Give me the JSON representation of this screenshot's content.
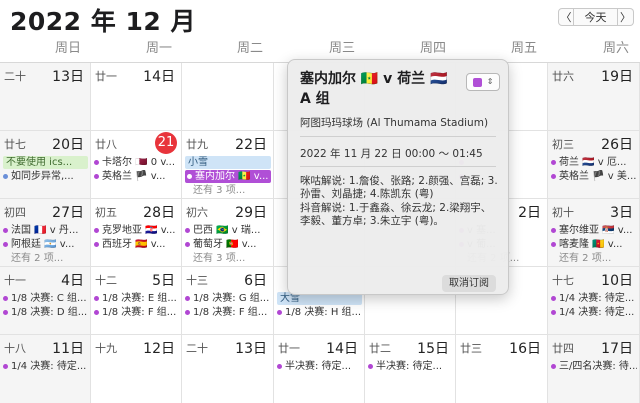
{
  "header": {
    "title": "2022 年 12 月",
    "prev_label": "〈",
    "today_label": "今天",
    "next_label": "〉"
  },
  "weekdays": [
    "周日",
    "周一",
    "周二",
    "周三",
    "周四",
    "周五",
    "周六"
  ],
  "weeks": [
    [
      {
        "lunar": "二十",
        "day": "13日",
        "events": []
      },
      {
        "lunar": "廿一",
        "day": "14日",
        "events": []
      },
      {
        "lunar": "",
        "day": "",
        "events": []
      },
      {
        "lunar": "",
        "day": "",
        "events": []
      },
      {
        "lunar": "",
        "day": "",
        "events": []
      },
      {
        "lunar": "",
        "day": "",
        "events": []
      },
      {
        "lunar": "廿六",
        "day": "19日",
        "events": []
      }
    ],
    [
      {
        "lunar": "廿七",
        "day": "20日",
        "events": [
          {
            "text": "不要使用 ics...",
            "style": "pill-green"
          },
          {
            "text": "如同步异常,...",
            "style": "dot-blue"
          }
        ]
      },
      {
        "lunar": "廿八",
        "day": "21",
        "events": [
          {
            "text": "卡塔尔 🇶🇦 0 v...",
            "style": "dot"
          },
          {
            "text": "英格兰 🏴 v...",
            "style": "dot"
          }
        ]
      },
      {
        "lunar": "廿九",
        "day": "22日",
        "events": [
          {
            "text": "小雪",
            "style": "pill-blue"
          },
          {
            "text": "塞内加尔 🇸🇳 v...",
            "style": "pill-sel"
          },
          {
            "text": "还有 3 项...",
            "style": "more"
          }
        ]
      },
      {
        "lunar": "",
        "day": "",
        "events": []
      },
      {
        "lunar": "",
        "day": "",
        "events": []
      },
      {
        "lunar": "",
        "day": "",
        "events": [
          {
            "text": "",
            "style": "dot"
          },
          {
            "text": "",
            "style": "dot"
          }
        ]
      },
      {
        "lunar": "初三",
        "day": "26日",
        "events": [
          {
            "text": "荷兰 🇳🇱 v 厄...",
            "style": "dot"
          },
          {
            "text": "英格兰 🏴 v 美...",
            "style": "dot"
          }
        ]
      }
    ],
    [
      {
        "lunar": "初四",
        "day": "27日",
        "events": [
          {
            "text": "法国 🇫🇷 v 丹...",
            "style": "dot"
          },
          {
            "text": "阿根廷 🇦🇷 v...",
            "style": "dot"
          },
          {
            "text": "还有 2 项...",
            "style": "more"
          }
        ]
      },
      {
        "lunar": "初五",
        "day": "28日",
        "events": [
          {
            "text": "克罗地亚 🇭🇷 v...",
            "style": "dot"
          },
          {
            "text": "西班牙 🇪🇸 v...",
            "style": "dot"
          }
        ]
      },
      {
        "lunar": "初六",
        "day": "29日",
        "events": [
          {
            "text": "巴西 🇧🇷 v 瑞...",
            "style": "dot"
          },
          {
            "text": "葡萄牙 🇵🇹 v...",
            "style": "dot"
          },
          {
            "text": "还有 3 项...",
            "style": "more"
          }
        ]
      },
      {
        "lunar": "",
        "day": "",
        "events": []
      },
      {
        "lunar": "",
        "day": "",
        "events": []
      },
      {
        "lunar": "",
        "day": "2日",
        "events": [
          {
            "text": "v 塞...",
            "style": "dot"
          },
          {
            "text": "v 葡...",
            "style": "dot"
          },
          {
            "text": "还有 2 项...",
            "style": "more"
          }
        ]
      },
      {
        "lunar": "初十",
        "day": "3日",
        "events": [
          {
            "text": "塞尔维亚 🇷🇸 v...",
            "style": "dot"
          },
          {
            "text": "喀麦隆 🇨🇲 v...",
            "style": "dot"
          },
          {
            "text": "还有 2 项...",
            "style": "more"
          }
        ]
      }
    ],
    [
      {
        "lunar": "十一",
        "day": "4日",
        "events": [
          {
            "text": "1/8 决赛: C 组...",
            "style": "dot"
          },
          {
            "text": "1/8 决赛: D 组...",
            "style": "dot"
          }
        ]
      },
      {
        "lunar": "十二",
        "day": "5日",
        "events": [
          {
            "text": "1/8 决赛: E 组...",
            "style": "dot"
          },
          {
            "text": "1/8 决赛: F 组...",
            "style": "dot"
          }
        ]
      },
      {
        "lunar": "十三",
        "day": "6日",
        "events": [
          {
            "text": "1/8 决赛: G 组...",
            "style": "dot"
          },
          {
            "text": "1/8 决赛: F 组...",
            "style": "dot"
          }
        ]
      },
      {
        "lunar": "",
        "day": "",
        "events": [
          {
            "text": "大雪",
            "style": "pill-blue"
          },
          {
            "text": "1/8 决赛: H 组...",
            "style": "dot"
          }
        ]
      },
      {
        "lunar": "",
        "day": "",
        "events": []
      },
      {
        "lunar": "",
        "day": "",
        "events": []
      },
      {
        "lunar": "十七",
        "day": "10日",
        "events": [
          {
            "text": "1/4 决赛: 待定...",
            "style": "dot"
          },
          {
            "text": "1/4 决赛: 待定...",
            "style": "dot"
          }
        ]
      }
    ],
    [
      {
        "lunar": "十八",
        "day": "11日",
        "events": [
          {
            "text": "1/4 决赛: 待定...",
            "style": "dot"
          }
        ]
      },
      {
        "lunar": "十九",
        "day": "12日",
        "events": []
      },
      {
        "lunar": "二十",
        "day": "13日",
        "events": []
      },
      {
        "lunar": "廿一",
        "day": "14日",
        "events": [
          {
            "text": "半决赛: 待定...",
            "style": "dot"
          }
        ]
      },
      {
        "lunar": "廿二",
        "day": "15日",
        "events": [
          {
            "text": "半决赛: 待定...",
            "style": "dot"
          }
        ]
      },
      {
        "lunar": "廿三",
        "day": "16日",
        "events": []
      },
      {
        "lunar": "廿四",
        "day": "17日",
        "events": [
          {
            "text": "三/四名决赛: 待...",
            "style": "dot"
          }
        ]
      }
    ]
  ],
  "popover": {
    "title": "塞内加尔 🇸🇳 v 荷兰 🇳🇱 A 组",
    "location": "阿图玛玛球场 (Al Thumama Stadium)",
    "time": "2022 年 11 月 22 日  00:00 ～ 01:45",
    "notes_1": "咪咕解说: 1.詹俊、张路; 2.颜强、宫磊; 3.孙雷、刘晶捷; 4.陈凯东 (粤)",
    "notes_2": "抖音解说: 1.于鑫淼、徐云龙; 2.梁翔宇、李毅、董方卓; 3.朱立宇 (粤)。",
    "unsubscribe_label": "取消订阅",
    "calendar_color": "#b04fd6"
  }
}
